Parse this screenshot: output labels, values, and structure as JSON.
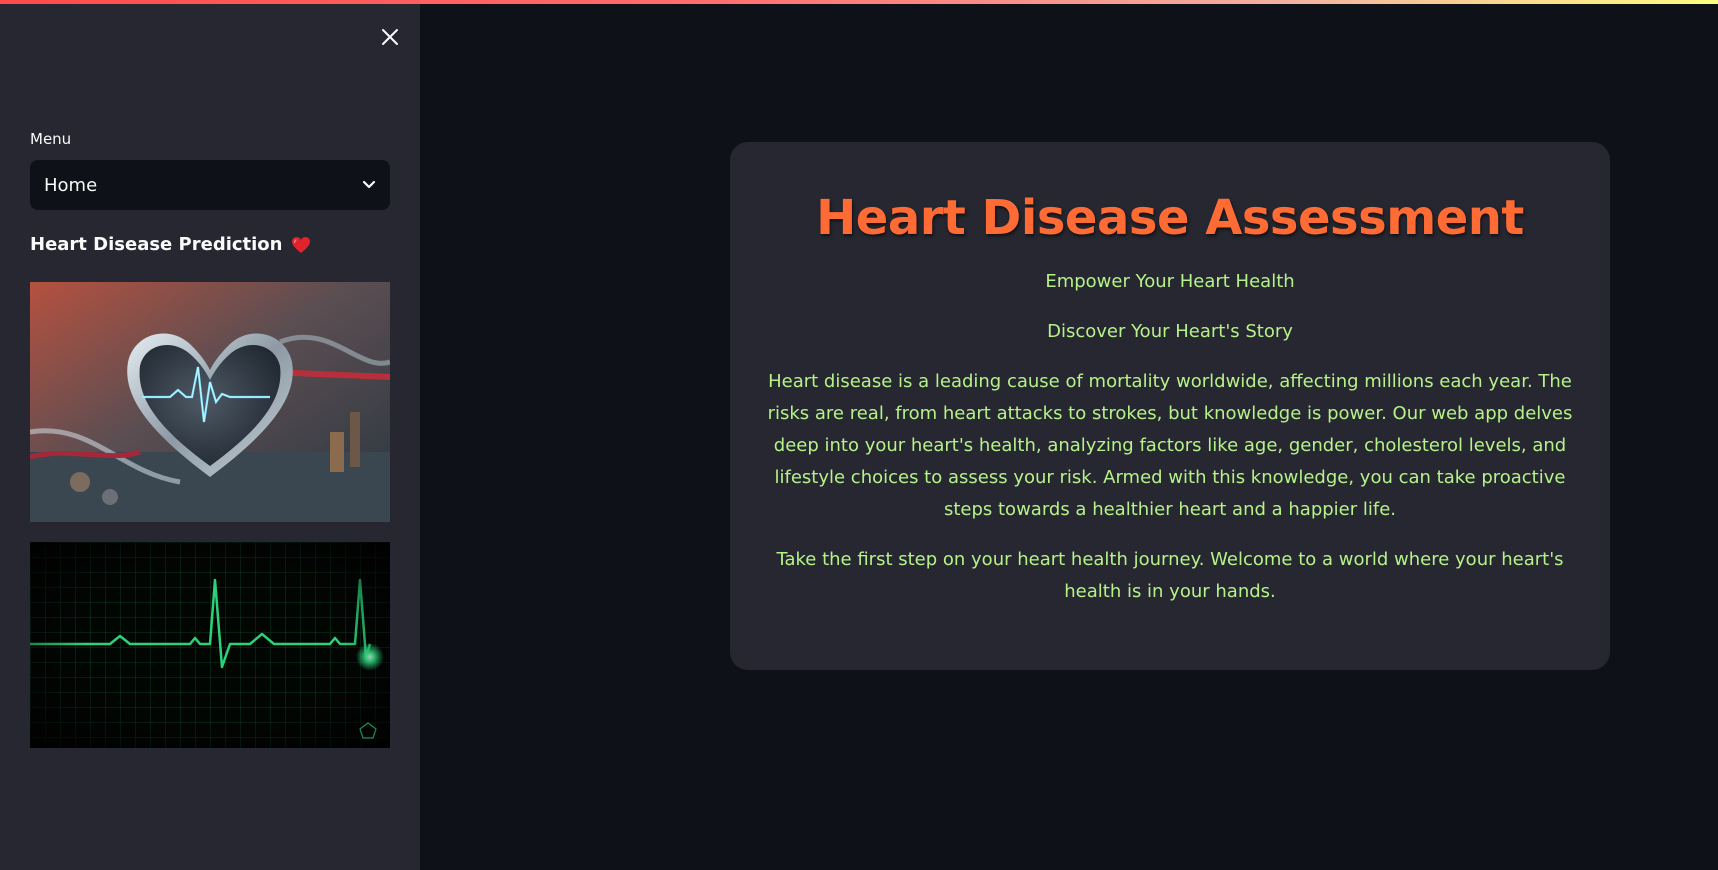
{
  "sidebar": {
    "menu_label": "Menu",
    "menu_selected": "Home",
    "heading": "Heart Disease Prediction",
    "heading_emoji": "❤️",
    "images": [
      {
        "name": "heart-monitor-image"
      },
      {
        "name": "ecg-line-image"
      }
    ]
  },
  "main": {
    "title": "Heart Disease Assessment",
    "subtitle_1": "Empower Your Heart Health",
    "subtitle_2": "Discover Your Heart's Story",
    "paragraph_1": "Heart disease is a leading cause of mortality worldwide, affecting millions each year. The risks are real, from heart attacks to strokes, but knowledge is power. Our web app delves deep into your heart's health, analyzing factors like age, gender, cholesterol levels, and lifestyle choices to assess your risk. Armed with this knowledge, you can take proactive steps towards a healthier heart and a happier life.",
    "paragraph_2": "Take the first step on your heart health journey. Welcome to a world where your heart's health is in your hands."
  },
  "icons": {
    "close": "close-icon",
    "dropdown": "chevron-down-icon"
  },
  "colors": {
    "background": "#0e1117",
    "sidebar": "#262730",
    "card": "#262730",
    "title": "#ff6b35",
    "text": "#b6f28a"
  }
}
